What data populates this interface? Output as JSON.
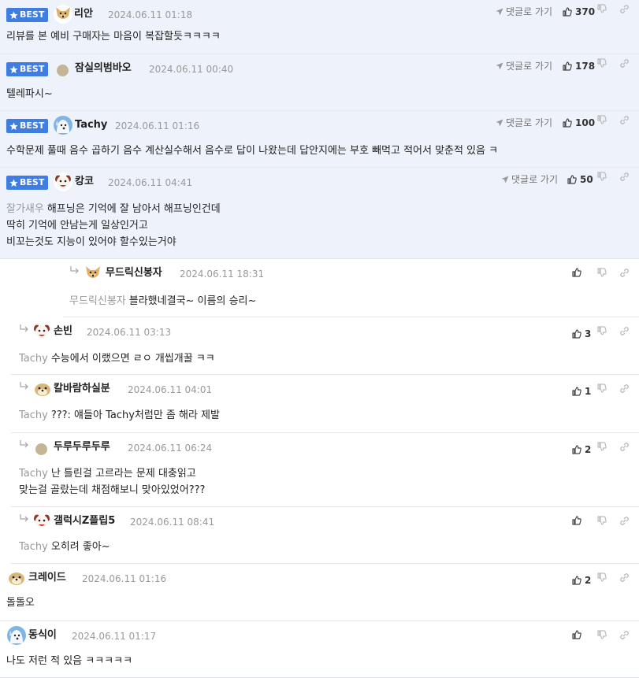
{
  "goto_label": "댓글로 가기",
  "comments": [
    {
      "type": "best",
      "badge": "BEST",
      "nick": "리안",
      "date": "2024.06.11 01:18",
      "goto": "댓글로 가기",
      "likes": "370",
      "lines": [
        "리뷰를 본 예비 구매자는 마음이 복잡할듯ㅋㅋㅋㅋ"
      ],
      "avatar": "dog-face-icon"
    },
    {
      "type": "best",
      "badge": "BEST",
      "nick": "잠실의범바오",
      "date": "2024.06.11 00:40",
      "goto": "댓글로 가기",
      "likes": "178",
      "lines": [
        "텔레파시~"
      ],
      "avatar": "dot-icon"
    },
    {
      "type": "best",
      "badge": "BEST",
      "nick": "Tachy",
      "date": "2024.06.11 01:16",
      "goto": "댓글로 가기",
      "likes": "100",
      "lines": [
        "수학문제 풀때 음수 곱하기 음수 계산실수해서 음수로 답이 나왔는데 답안지에는 부호 빼먹고 적어서 맞춘적 있음 ㅋ"
      ],
      "avatar": "blue-dog-icon"
    },
    {
      "type": "best",
      "badge": "BEST",
      "nick": "캉코",
      "date": "2024.06.11 04:41",
      "goto": "댓글로 가기",
      "likes": "50",
      "to": "잘가새우",
      "lines": [
        "해프닝은 기억에 잘 남아서 해프닝인건데",
        "딱히 기억에 안남는게 일상인거고",
        "비꼬는것도 지능이 있어야 할수있는거야"
      ],
      "avatar": "puppy-icon"
    },
    {
      "type": "reply",
      "nick": "무드릭신봉자",
      "date": "2024.06.11 18:31",
      "likes": "",
      "to": "무드릭신봉자",
      "lines": [
        "블라했네결국~ 이름의 승리~"
      ],
      "avatar": "dog-face-icon"
    },
    {
      "type": "reply",
      "nick": "손빈",
      "date": "2024.06.11 03:13",
      "likes": "3",
      "to": "Tachy",
      "lines": [
        "수능에서 이랬으면 ㄹㅇ 개씹개꿀 ㅋㅋ"
      ],
      "avatar": "puppy-icon"
    },
    {
      "type": "reply",
      "nick": "칼바람하실분",
      "date": "2024.06.11 04:01",
      "likes": "1",
      "to": "Tachy",
      "lines": [
        "???: 얘들아 Tachy처럼만 좀 해라 제발"
      ],
      "avatar": "shiba-icon"
    },
    {
      "type": "reply",
      "nick": "두루두루두루",
      "date": "2024.06.11 06:24",
      "likes": "2",
      "to": "Tachy",
      "lines": [
        "난 틀린걸 고르라는 문제 대충읽고",
        "맞는걸 골랐는데 채점해보니 맞아있었어???"
      ],
      "avatar": "dot-icon"
    },
    {
      "type": "reply",
      "nick": "갤럭시Z플립5",
      "date": "2024.06.11 08:41",
      "likes": "",
      "to": "Tachy",
      "lines": [
        "오히려 좋아~"
      ],
      "avatar": "puppy-icon"
    },
    {
      "type": "plain",
      "nick": "크레이드",
      "date": "2024.06.11 01:16",
      "likes": "2",
      "lines": [
        "돌돌오"
      ],
      "avatar": "shiba-icon"
    },
    {
      "type": "plain",
      "nick": "동식이",
      "date": "2024.06.11 01:17",
      "likes": "",
      "lines": [
        "나도 저런 적 있음 ㅋㅋㅋㅋㅋ"
      ],
      "avatar": "blue-dog-icon"
    }
  ],
  "colors": {
    "best_bg": "#eef2fa",
    "badge": "#3f7de0",
    "date": "#999999",
    "border": "#e3e6ea"
  }
}
